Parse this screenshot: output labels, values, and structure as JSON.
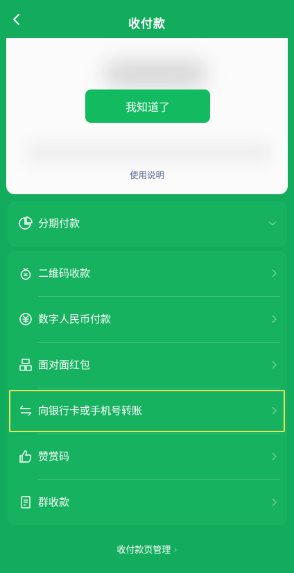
{
  "header": {
    "title": "收付款",
    "back_icon": "chevron-left-icon"
  },
  "card": {
    "confirm_label": "我知道了",
    "help_link": "使用说明",
    "accent": "#12ba60",
    "link_color": "#576b95"
  },
  "installment": {
    "label": "分期付款",
    "icon": "pie-chart-icon"
  },
  "items": [
    {
      "label": "二维码收款",
      "icon": "money-bag-icon"
    },
    {
      "label": "数字人民币付款",
      "icon": "digital-yuan-icon"
    },
    {
      "label": "面对面红包",
      "icon": "face-to-face-icon"
    },
    {
      "label": "向银行卡或手机号转账",
      "icon": "transfer-arrows-icon"
    },
    {
      "label": "赞赏码",
      "icon": "thumbs-up-icon"
    },
    {
      "label": "群收款",
      "icon": "group-receipt-icon"
    }
  ],
  "footer": {
    "label": "收付款页管理",
    "chevron": "›"
  },
  "colors": {
    "background": "#12ac5c",
    "highlight": "#e6e65a"
  }
}
